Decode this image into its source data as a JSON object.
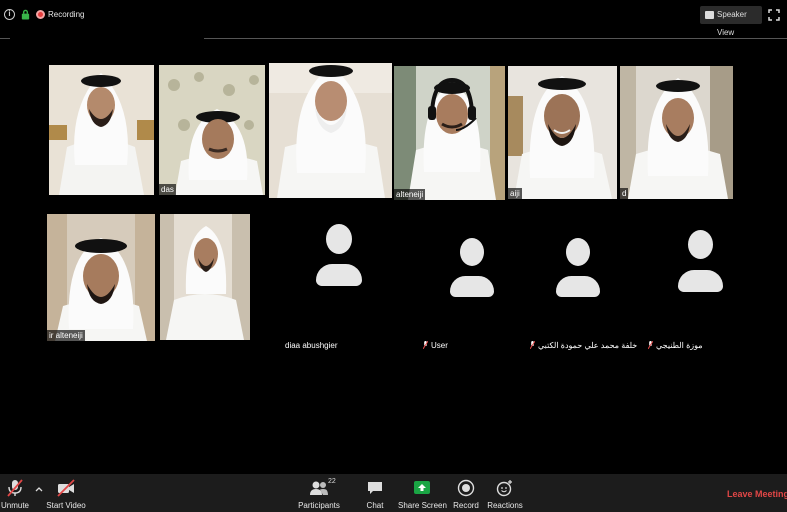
{
  "topbar": {
    "recording_label": "Recording",
    "speaker_view_label": "Speaker View"
  },
  "video_tiles": [
    {
      "name": ""
    },
    {
      "name": "das"
    },
    {
      "name": ""
    },
    {
      "name": "alteneiji"
    },
    {
      "name": "aiji"
    },
    {
      "name": "d"
    },
    {
      "name": "ir alteneiji"
    },
    {
      "name": ""
    }
  ],
  "audio_participants": [
    {
      "name": "diaa abushgier",
      "muted": false
    },
    {
      "name": "User",
      "muted": true
    },
    {
      "name": "خلفة محمد علي حمودة الكتبي",
      "muted": true
    },
    {
      "name": "موزة الطنيجي",
      "muted": true
    }
  ],
  "toolbar": {
    "unmute_label": "Unmute",
    "start_video_label": "Start Video",
    "participants_label": "Participants",
    "participants_count": "22",
    "chat_label": "Chat",
    "share_screen_label": "Share Screen",
    "record_label": "Record",
    "reactions_label": "Reactions",
    "leave_label": "Leave Meeting"
  },
  "colors": {
    "background": "#000000",
    "toolbar": "#1c1c1c",
    "recording": "#e63d3d",
    "leave": "#e04646",
    "share_screen": "#1aa544"
  },
  "icons": [
    "info-icon",
    "lock-icon",
    "recording-icon",
    "speaker-view-icon",
    "fullscreen-icon",
    "microphone-muted-icon",
    "chevron-up-icon",
    "video-off-icon",
    "participants-icon",
    "chat-icon",
    "share-screen-icon",
    "record-icon",
    "reactions-icon",
    "avatar-icon"
  ]
}
